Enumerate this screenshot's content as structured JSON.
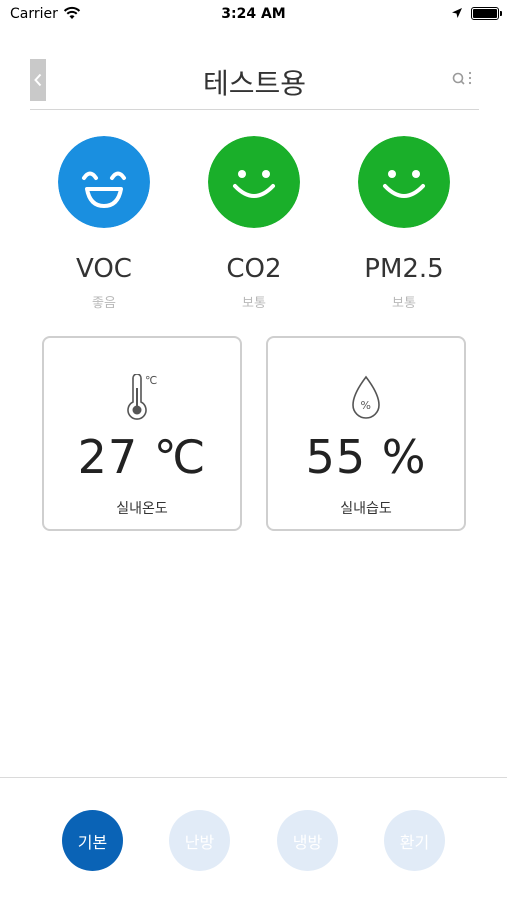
{
  "status_bar": {
    "carrier": "Carrier",
    "time": "3:24 AM"
  },
  "header": {
    "title": "테스트용",
    "back_icon": "chevron-left-icon",
    "search_icon": "search-icon"
  },
  "air_quality": [
    {
      "name": "VOC",
      "status": "좋음",
      "face_color": "#1a8fe0",
      "icon": "laughing-face-icon"
    },
    {
      "name": "CO2",
      "status": "보통",
      "face_color": "#1aaf2a",
      "icon": "smiling-face-icon"
    },
    {
      "name": "PM2.5",
      "status": "보통",
      "face_color": "#1aaf2a",
      "icon": "smiling-face-icon"
    }
  ],
  "cards": [
    {
      "value": "27 ℃",
      "label": "실내온도",
      "icon": "thermometer-icon",
      "icon_unit": "℃"
    },
    {
      "value": "55 %",
      "label": "실내습도",
      "icon": "humidity-drop-icon"
    }
  ],
  "modes": [
    {
      "label": "기본",
      "active": true
    },
    {
      "label": "난방",
      "active": false
    },
    {
      "label": "냉방",
      "active": false
    },
    {
      "label": "환기",
      "active": false
    }
  ],
  "colors": {
    "accent": "#0a63b6",
    "good": "#1a8fe0",
    "normal": "#1aaf2a",
    "inactive_mode": "#e1ebf7"
  }
}
